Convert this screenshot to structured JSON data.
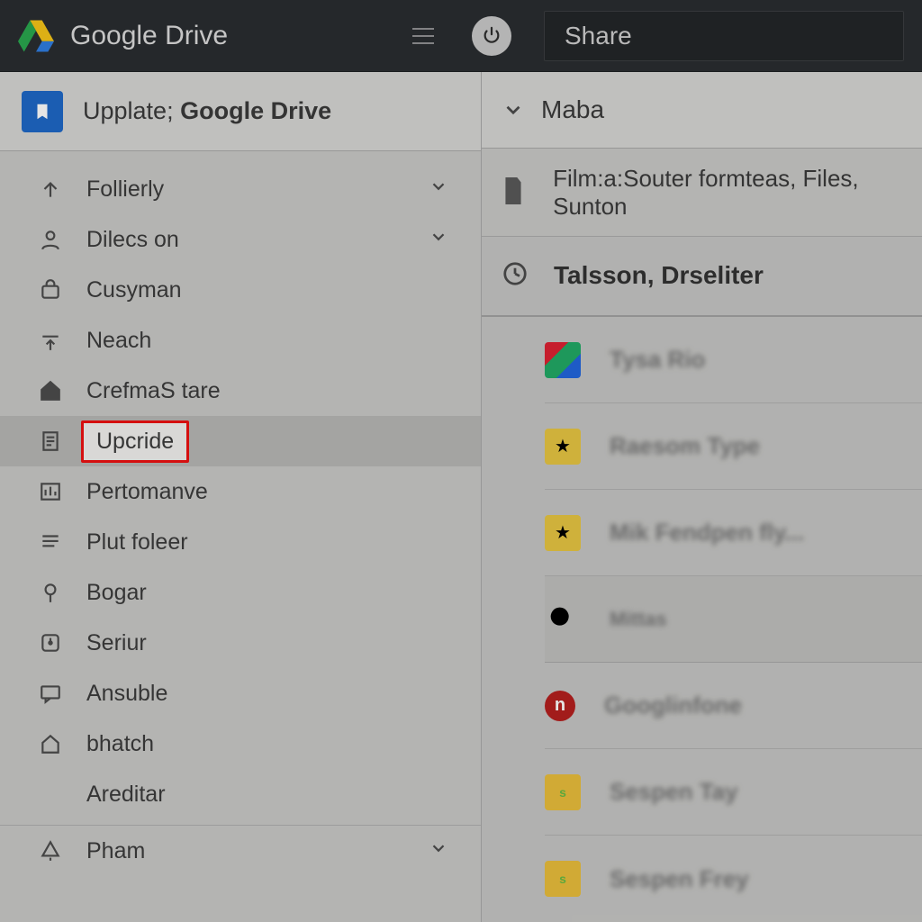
{
  "header": {
    "brand_prefix": "Google",
    "brand_suffix": "Drive",
    "share_label": "Share"
  },
  "sidebar": {
    "title_prefix": "Upplate;",
    "title_bold": "Google Drive",
    "items": [
      {
        "label": "Follierly",
        "icon": "arrow-up",
        "has_chevron": true
      },
      {
        "label": "Dilecs on",
        "icon": "person",
        "has_chevron": true
      },
      {
        "label": "Cusyman",
        "icon": "package"
      },
      {
        "label": "Neach",
        "icon": "upload"
      },
      {
        "label": "CrefmaS tare",
        "icon": "home"
      },
      {
        "label": "Upcride",
        "icon": "doc",
        "selected": true
      },
      {
        "label": "Pertomanve",
        "icon": "chart"
      },
      {
        "label": "Plut foleer",
        "icon": "lines"
      },
      {
        "label": "Bogar",
        "icon": "pin"
      },
      {
        "label": "Seriur",
        "icon": "clock"
      },
      {
        "label": "Ansuble",
        "icon": "chat"
      },
      {
        "label": "bhatch",
        "icon": "home-outline"
      },
      {
        "label": "Areditar",
        "icon": ""
      }
    ],
    "bottom": {
      "label": "Pham",
      "icon": "bell",
      "has_chevron": true
    }
  },
  "main": {
    "breadcrumb": "Maba",
    "path_text": "Film:a:Souter formteas, Files, Sunton",
    "activity_title": "Talsson, Drseliter",
    "files": [
      {
        "thumb": "multi",
        "label": "Tysa Rio"
      },
      {
        "thumb": "star",
        "label": "Raesom Type"
      },
      {
        "thumb": "star",
        "label": "Mik Fendpen fly..."
      },
      {
        "thumb": "search",
        "label": "Mittas",
        "highlight": true,
        "small": true
      },
      {
        "thumb": "red",
        "label": "Googlinfone"
      },
      {
        "thumb": "slide",
        "label": "Sespen Tay"
      },
      {
        "thumb": "slide",
        "label": "Sespen Frey"
      }
    ]
  }
}
